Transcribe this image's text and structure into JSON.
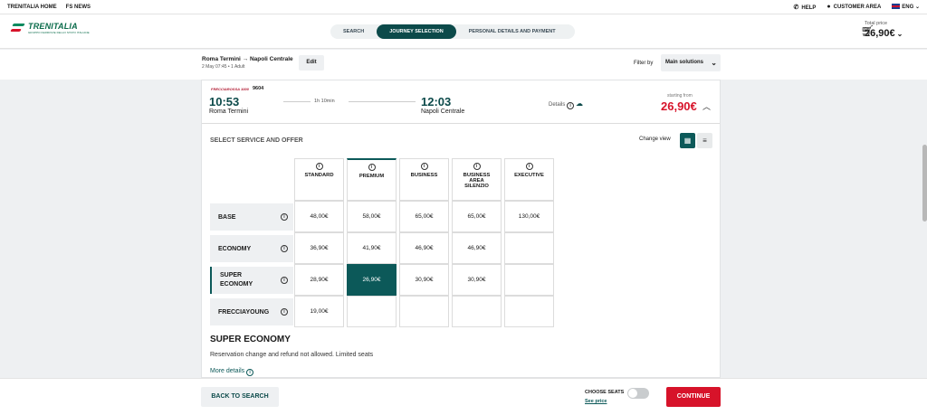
{
  "topbar": {
    "links": [
      "TRENITALIA HOME",
      "FS NEWS"
    ],
    "help": "HELP",
    "customer_area": "CUSTOMER AREA",
    "language": "ENG"
  },
  "header": {
    "logo_text": "TRENITALIA",
    "logo_subtext": "GRUPPO FERROVIE DELLO STATO ITALIANE",
    "steps": [
      "SEARCH",
      "JOURNEY SELECTION",
      "PERSONAL DETAILS AND PAYMENT"
    ],
    "active_step": "JOURNEY SELECTION",
    "total_label": "Total price",
    "total_value": "26,90€"
  },
  "trip": {
    "route": "Roma Termini → Napoli Centrale",
    "summary": "2 May 07:45 • 1 Adult",
    "edit_label": "Edit",
    "filter_label": "Filter by",
    "filter_value": "Main solutions"
  },
  "solution": {
    "train_brand": "FRECCIAROSSA 1000",
    "train_number": "9604",
    "departure_time": "10:53",
    "departure_station": "Roma Termini",
    "duration": "1h 10min",
    "arrival_time": "12:03",
    "arrival_station": "Napoli Centrale",
    "details_label": "Details",
    "starting_label": "starting from",
    "starting_price": "26,90€"
  },
  "offers": {
    "title": "SELECT SERVICE AND OFFER",
    "change_view": "Change view",
    "services": [
      "STANDARD",
      "PREMIUM",
      "BUSINESS",
      "BUSINESS AREA SILENZIO",
      "EXECUTIVE"
    ],
    "rows": [
      {
        "label": "BASE",
        "prices": [
          "48,00€",
          "58,00€",
          "65,00€",
          "65,00€",
          "130,00€"
        ]
      },
      {
        "label": "ECONOMY",
        "prices": [
          "36,90€",
          "41,90€",
          "46,90€",
          "46,90€",
          ""
        ]
      },
      {
        "label": "SUPER ECONOMY",
        "prices": [
          "28,90€",
          "26,90€",
          "30,90€",
          "30,90€",
          ""
        ]
      },
      {
        "label": "FRECCIAYOUNG",
        "prices": [
          "19,00€",
          "",
          "",
          "",
          ""
        ]
      }
    ],
    "selected": "SUPER ECONOMY / PREMIUM"
  },
  "description": {
    "title": "SUPER ECONOMY",
    "text": "Reservation change and refund not allowed. Limited seats",
    "more": "More details"
  },
  "footer": {
    "back": "BACK TO SEARCH",
    "seats_label": "CHOOSE SEATS",
    "seats_link": "See price",
    "continue": "CONTINUE"
  }
}
